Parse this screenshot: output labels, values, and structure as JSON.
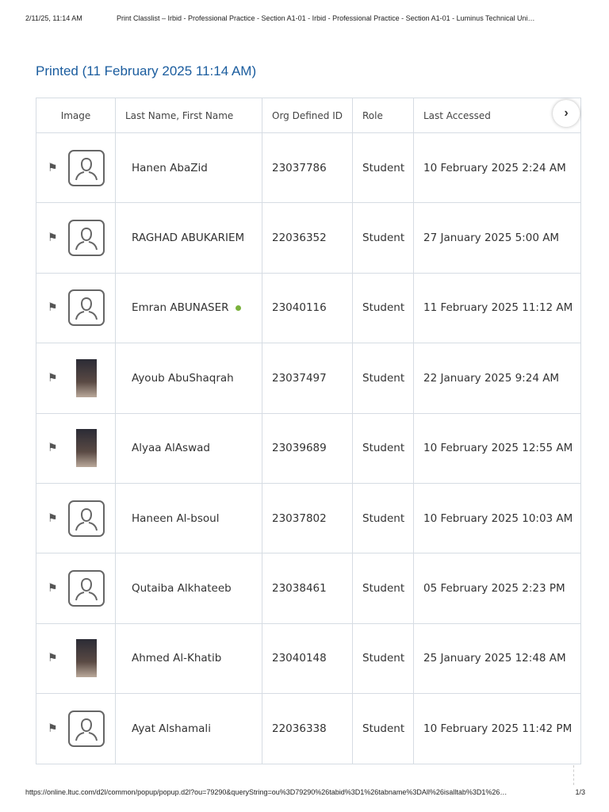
{
  "header": {
    "date": "2/11/25, 11:14 AM",
    "title": "Print Classlist – Irbid - Professional Practice - Section A1-01 - Irbid - Professional Practice - Section A1-01 - Luminus Technical Uni…"
  },
  "page_title": "Printed (11 February 2025 11:14 AM)",
  "columns": [
    "Image",
    "Last Name, First Name",
    "Org Defined ID",
    "Role",
    "Last Accessed"
  ],
  "rows": [
    {
      "name": "Hanen AbaZid",
      "id": "23037786",
      "role": "Student",
      "accessed": "10 February 2025 2:24 AM",
      "photo": false,
      "online": false
    },
    {
      "name": "RAGHAD ABUKARIEM",
      "id": "22036352",
      "role": "Student",
      "accessed": "27 January 2025 5:00 AM",
      "photo": false,
      "online": false
    },
    {
      "name": "Emran ABUNASER",
      "id": "23040116",
      "role": "Student",
      "accessed": "11 February 2025 11:12 AM",
      "photo": false,
      "online": true
    },
    {
      "name": "Ayoub AbuShaqrah",
      "id": "23037497",
      "role": "Student",
      "accessed": "22 January 2025 9:24 AM",
      "photo": true,
      "online": false
    },
    {
      "name": "Alyaa AlAswad",
      "id": "23039689",
      "role": "Student",
      "accessed": "10 February 2025 12:55 AM",
      "photo": true,
      "online": false
    },
    {
      "name": "Haneen Al-bsoul",
      "id": "23037802",
      "role": "Student",
      "accessed": "10 February 2025 10:03 AM",
      "photo": false,
      "online": false
    },
    {
      "name": "Qutaiba Alkhateeb",
      "id": "23038461",
      "role": "Student",
      "accessed": "05 February 2025 2:23 PM",
      "photo": false,
      "online": false
    },
    {
      "name": "Ahmed Al-Khatib",
      "id": "23040148",
      "role": "Student",
      "accessed": "25 January 2025 12:48 AM",
      "photo": true,
      "online": false
    },
    {
      "name": "Ayat Alshamali",
      "id": "22036338",
      "role": "Student",
      "accessed": "10 February 2025 11:42 PM",
      "photo": false,
      "online": false
    }
  ],
  "footer": {
    "url": "https://online.ltuc.com/d2l/common/popup/popup.d2l?ou=79290&queryString=ou%3D79290%26tabid%3D1%26tabname%3DAll%26isalltab%3D1%26…",
    "page": "1/3"
  }
}
